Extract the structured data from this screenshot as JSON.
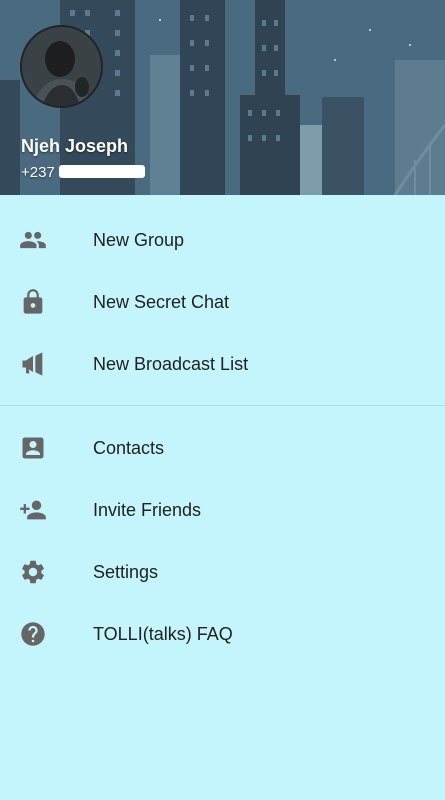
{
  "header": {
    "user_name": "Njeh Joseph",
    "user_phone_prefix": "+237"
  },
  "menu": {
    "section_1": [
      {
        "label": "New Group",
        "icon": "group-icon"
      },
      {
        "label": "New Secret Chat",
        "icon": "lock-icon"
      },
      {
        "label": "New Broadcast List",
        "icon": "megaphone-icon"
      }
    ],
    "section_2": [
      {
        "label": "Contacts",
        "icon": "contacts-icon"
      },
      {
        "label": "Invite Friends",
        "icon": "add-person-icon"
      },
      {
        "label": "Settings",
        "icon": "gear-icon"
      },
      {
        "label": "TOLLI(talks) FAQ",
        "icon": "help-icon"
      }
    ]
  },
  "colors": {
    "drawer_background": "#c4f5fd",
    "icon": "#666666",
    "label_text": "#212121"
  }
}
